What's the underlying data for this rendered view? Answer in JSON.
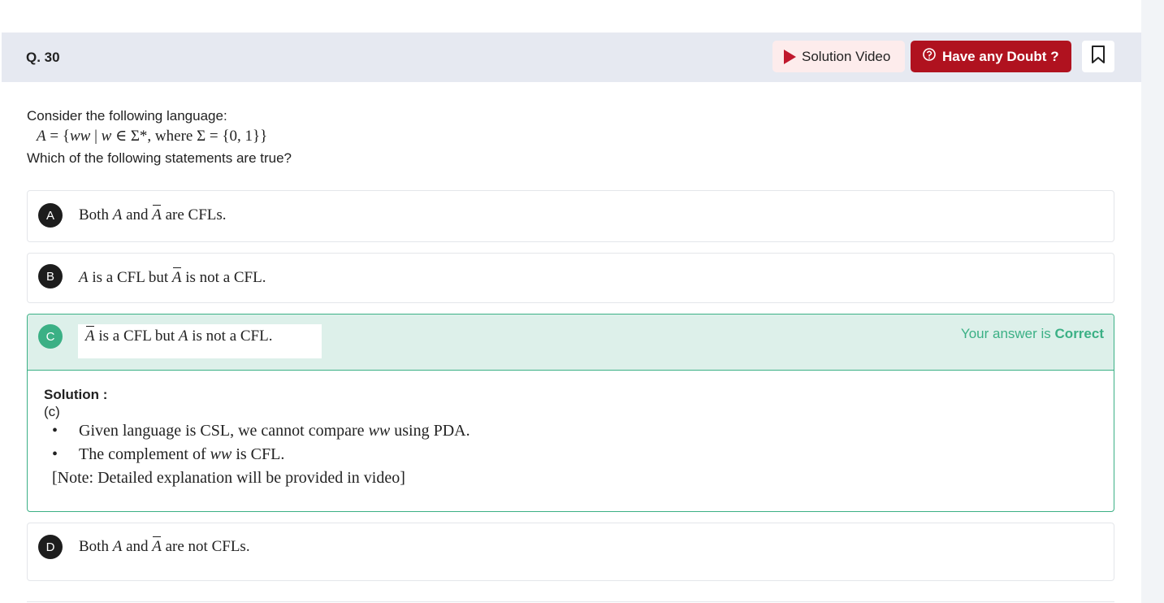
{
  "question": {
    "number": "Q. 30",
    "intro": "Consider the following language:",
    "prompt": "Which of the following statements are true?"
  },
  "header": {
    "solution_video_label": "Solution Video",
    "doubt_label": "Have any Doubt ?",
    "icons": [
      "play-icon",
      "doubt-icon",
      "bookmark-icon"
    ],
    "accent_color": "#b0121f"
  },
  "options": [
    {
      "letter": "A"
    },
    {
      "letter": "B"
    },
    {
      "letter": "C",
      "status_prefix": "Your answer is ",
      "status_value": "Correct",
      "status_color": "#3bb085"
    },
    {
      "letter": "D"
    }
  ],
  "solution": {
    "title": "Solution :",
    "answer": "(c)"
  }
}
